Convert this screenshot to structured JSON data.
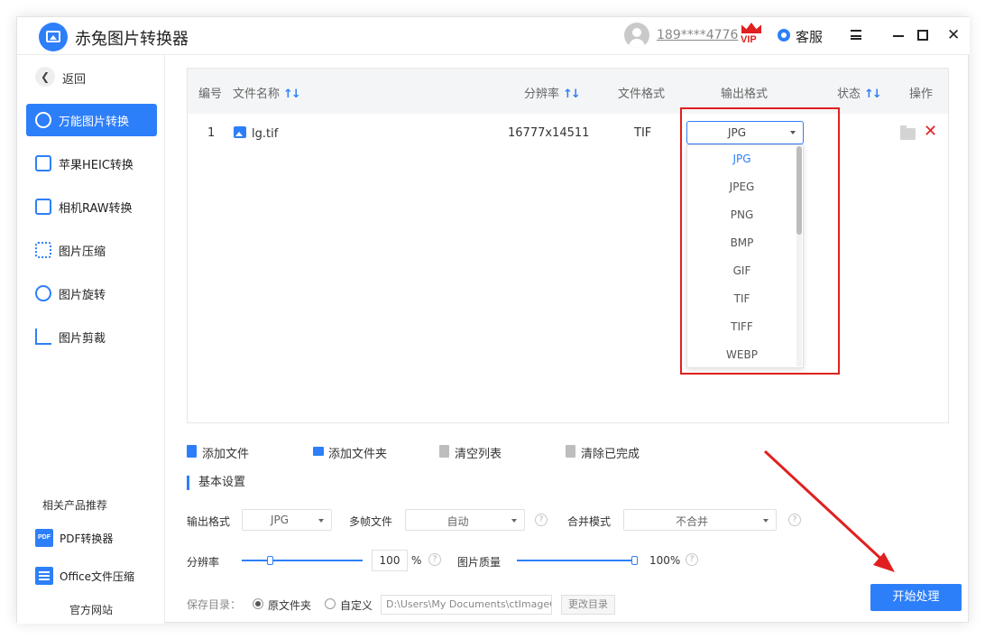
{
  "app": {
    "title": "赤兔图片转换器",
    "user_phone": "189****4776",
    "vip_label": "VIP",
    "service_label": "客服"
  },
  "sidebar": {
    "back_label": "返回",
    "items": [
      {
        "label": "万能图片转换",
        "icon": "image-convert-icon",
        "active": true
      },
      {
        "label": "苹果HEIC转换",
        "icon": "heic-icon",
        "active": false
      },
      {
        "label": "相机RAW转换",
        "icon": "raw-icon",
        "active": false
      },
      {
        "label": "图片压缩",
        "icon": "compress-icon",
        "active": false
      },
      {
        "label": "图片旋转",
        "icon": "rotate-icon",
        "active": false
      },
      {
        "label": "图片剪裁",
        "icon": "crop-icon",
        "active": false
      }
    ],
    "related_title": "相关产品推荐",
    "related": [
      {
        "label": "PDF转换器",
        "icon_text": "PDF"
      },
      {
        "label": "Office文件压缩",
        "icon_text": ""
      }
    ],
    "website_label": "官方网站"
  },
  "table": {
    "headers": {
      "index": "编号",
      "filename": "文件名称",
      "resolution": "分辨率",
      "file_format": "文件格式",
      "output_format": "输出格式",
      "status": "状态",
      "actions": "操作"
    },
    "rows": [
      {
        "index": "1",
        "filename": "lg.tif",
        "resolution": "16777x14511",
        "file_format": "TIF",
        "output_format": "JPG",
        "status": ""
      }
    ],
    "dropdown_options": [
      "JPG",
      "JPEG",
      "PNG",
      "BMP",
      "GIF",
      "TIF",
      "TIFF",
      "WEBP"
    ],
    "dropdown_selected": "JPG"
  },
  "toolbar": {
    "add_file": "添加文件",
    "add_folder": "添加文件夹",
    "clear_list": "清空列表",
    "clear_done": "清除已完成"
  },
  "settings": {
    "title": "基本设置",
    "output_format_label": "输出格式",
    "output_format_value": "JPG",
    "multiframe_label": "多帧文件",
    "multiframe_value": "自动",
    "merge_label": "合并模式",
    "merge_value": "不合并",
    "resolution_label": "分辨率",
    "resolution_value": "100",
    "resolution_unit": "%",
    "resolution_level": 0.22,
    "quality_label": "图片质量",
    "quality_value": "100%",
    "quality_level": 1.0,
    "save_dir_label": "保存目录：",
    "radio_original": "原文件夹",
    "radio_custom": "自定义",
    "path_value": "D:\\Users\\My Documents\\ctImageC",
    "change_dir_label": "更改目录"
  },
  "start_button": "开始处理",
  "colors": {
    "accent": "#2d7ff9",
    "highlight": "#e02020"
  }
}
